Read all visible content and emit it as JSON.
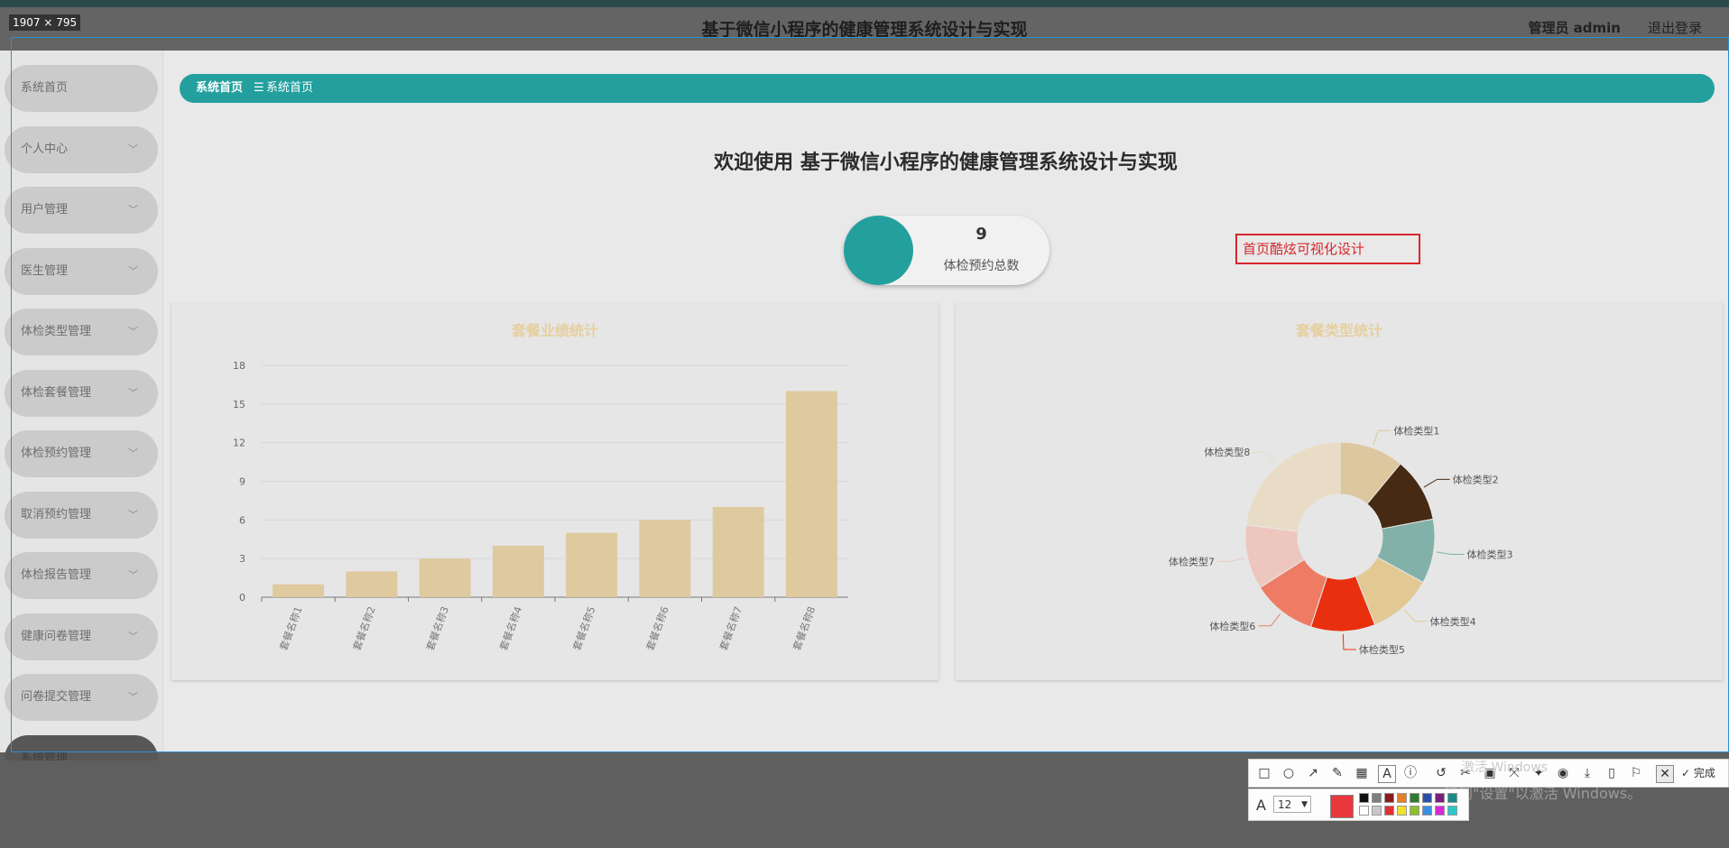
{
  "header": {
    "title": "基于微信小程序的健康管理系统设计与实现",
    "user": "管理员 admin",
    "logout": "退出登录"
  },
  "selection_label": "1907 × 795",
  "sidebar": {
    "items": [
      {
        "label": "系统首页",
        "chevron": false
      },
      {
        "label": "个人中心",
        "chevron": true
      },
      {
        "label": "用户管理",
        "chevron": true
      },
      {
        "label": "医生管理",
        "chevron": true
      },
      {
        "label": "体检类型管理",
        "chevron": true
      },
      {
        "label": "体检套餐管理",
        "chevron": true
      },
      {
        "label": "体检预约管理",
        "chevron": true
      },
      {
        "label": "取消预约管理",
        "chevron": true
      },
      {
        "label": "体检报告管理",
        "chevron": true
      },
      {
        "label": "健康问卷管理",
        "chevron": true
      },
      {
        "label": "问卷提交管理",
        "chevron": true
      },
      {
        "label": "系统管理",
        "chevron": true
      }
    ]
  },
  "breadcrumb": {
    "first": "系统首页",
    "separator": "☰",
    "second": "系统首页"
  },
  "welcome": "欢迎使用 基于微信小程序的健康管理系统设计与实现",
  "stat": {
    "value": "9",
    "label": "体检预约总数"
  },
  "annotation": "首页酷炫可视化设计",
  "chart_data": [
    {
      "type": "bar",
      "title": "套餐业绩统计",
      "categories": [
        "套餐名称1",
        "套餐名称2",
        "套餐名称3",
        "套餐名称4",
        "套餐名称5",
        "套餐名称6",
        "套餐名称7",
        "套餐名称8"
      ],
      "values": [
        1,
        2,
        3,
        4,
        5,
        6,
        7,
        16
      ],
      "yticks": [
        0,
        3,
        6,
        9,
        12,
        15,
        18
      ],
      "ylim": [
        0,
        18
      ],
      "grid": true,
      "color": "#dfc99e"
    },
    {
      "type": "pie",
      "variant": "donut",
      "title": "套餐类型统计",
      "labels": [
        "体检类型1",
        "体检类型2",
        "体检类型3",
        "体检类型4",
        "体检类型5",
        "体检类型6",
        "体检类型7",
        "体检类型8"
      ],
      "values": [
        11,
        11,
        11,
        11,
        11,
        11,
        11,
        23
      ],
      "colors": [
        "#dcc79f",
        "#462a14",
        "#82b1aa",
        "#e2c993",
        "#e8300f",
        "#ee7c64",
        "#edc7be",
        "#e9dcc6"
      ]
    }
  ],
  "toolbar": {
    "done_label": "完成",
    "font_size": "12",
    "selected_color": "#e8383d",
    "palette": [
      "#111111",
      "#7f7f7f",
      "#8b1a1a",
      "#e87d2a",
      "#2f7b2f",
      "#2b4fa8",
      "#7a1f7a",
      "#178a8a",
      "#ffffff",
      "#c8c8c8",
      "#e23030",
      "#f2e22a",
      "#8fbf2a",
      "#3a8fe0",
      "#d62ad6",
      "#2ac8c8"
    ]
  },
  "watermark": "转到\"设置\"以激活 Windows。",
  "watermark_top": "激活 Windows"
}
